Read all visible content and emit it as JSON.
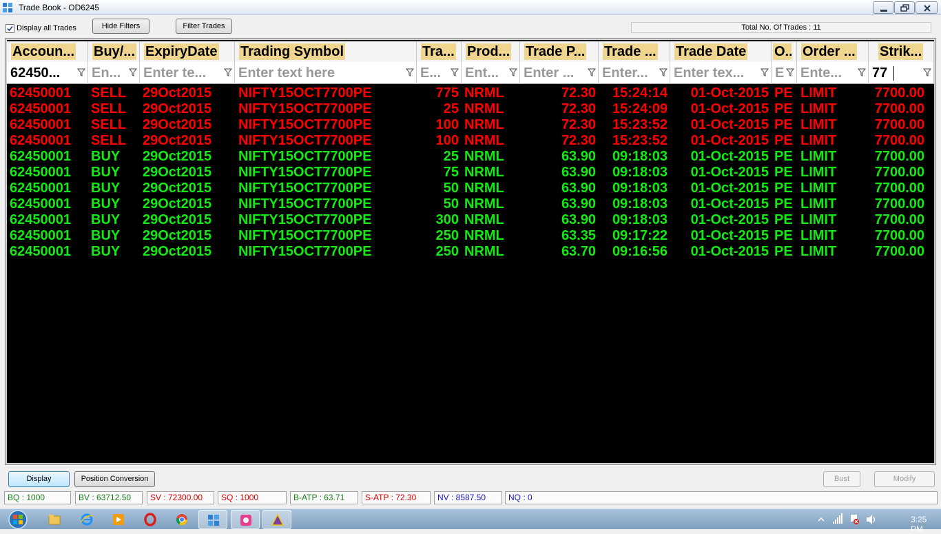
{
  "window": {
    "title": "Trade Book - OD6245"
  },
  "toolbar": {
    "display_all_label": "Display all Trades",
    "display_all_checked": true,
    "hide_filters_label": "Hide Filters",
    "filter_trades_label": "Filter Trades",
    "total_trades_text": "Total No. Of Trades : 11"
  },
  "grid": {
    "columns": [
      {
        "key": "account",
        "label": "Accoun...",
        "filter": "62450...",
        "filter_is_value": true
      },
      {
        "key": "buysell",
        "label": "Buy/...",
        "filter": "En...",
        "filter_is_value": false
      },
      {
        "key": "expiry",
        "label": "ExpiryDate",
        "filter": "Enter te...",
        "filter_is_value": false
      },
      {
        "key": "symbol",
        "label": "Trading Symbol",
        "filter": "Enter text here",
        "filter_is_value": false
      },
      {
        "key": "qty",
        "label": "Tra...",
        "filter": "E...",
        "filter_is_value": false
      },
      {
        "key": "product",
        "label": "Prod...",
        "filter": "Ent...",
        "filter_is_value": false
      },
      {
        "key": "price",
        "label": "Trade P...",
        "filter": "Enter ...",
        "filter_is_value": false
      },
      {
        "key": "time",
        "label": "Trade ...",
        "filter": "Enter...",
        "filter_is_value": false
      },
      {
        "key": "date",
        "label": "Trade Date",
        "filter": "Enter tex...",
        "filter_is_value": false
      },
      {
        "key": "opt",
        "label": "O...",
        "filter": "E",
        "filter_is_value": false
      },
      {
        "key": "ordertype",
        "label": "Order ...",
        "filter": "Ente...",
        "filter_is_value": false
      },
      {
        "key": "strike",
        "label": "Strik...",
        "filter": "77",
        "filter_is_value": true
      }
    ],
    "rows": [
      {
        "side_type": "sell",
        "account": "62450001",
        "buysell": "SELL",
        "expiry": "29Oct2015",
        "symbol": "NIFTY15OCT7700PE",
        "qty": "775",
        "product": "NRML",
        "price": "72.30",
        "time": "15:24:14",
        "date": "01-Oct-2015",
        "opt": "PE",
        "ordertype": "LIMIT",
        "strike": "7700.00"
      },
      {
        "side_type": "sell",
        "account": "62450001",
        "buysell": "SELL",
        "expiry": "29Oct2015",
        "symbol": "NIFTY15OCT7700PE",
        "qty": "25",
        "product": "NRML",
        "price": "72.30",
        "time": "15:24:09",
        "date": "01-Oct-2015",
        "opt": "PE",
        "ordertype": "LIMIT",
        "strike": "7700.00"
      },
      {
        "side_type": "sell",
        "account": "62450001",
        "buysell": "SELL",
        "expiry": "29Oct2015",
        "symbol": "NIFTY15OCT7700PE",
        "qty": "100",
        "product": "NRML",
        "price": "72.30",
        "time": "15:23:52",
        "date": "01-Oct-2015",
        "opt": "PE",
        "ordertype": "LIMIT",
        "strike": "7700.00"
      },
      {
        "side_type": "sell",
        "account": "62450001",
        "buysell": "SELL",
        "expiry": "29Oct2015",
        "symbol": "NIFTY15OCT7700PE",
        "qty": "100",
        "product": "NRML",
        "price": "72.30",
        "time": "15:23:52",
        "date": "01-Oct-2015",
        "opt": "PE",
        "ordertype": "LIMIT",
        "strike": "7700.00"
      },
      {
        "side_type": "buy",
        "account": "62450001",
        "buysell": "BUY",
        "expiry": "29Oct2015",
        "symbol": "NIFTY15OCT7700PE",
        "qty": "25",
        "product": "NRML",
        "price": "63.90",
        "time": "09:18:03",
        "date": "01-Oct-2015",
        "opt": "PE",
        "ordertype": "LIMIT",
        "strike": "7700.00"
      },
      {
        "side_type": "buy",
        "account": "62450001",
        "buysell": "BUY",
        "expiry": "29Oct2015",
        "symbol": "NIFTY15OCT7700PE",
        "qty": "75",
        "product": "NRML",
        "price": "63.90",
        "time": "09:18:03",
        "date": "01-Oct-2015",
        "opt": "PE",
        "ordertype": "LIMIT",
        "strike": "7700.00"
      },
      {
        "side_type": "buy",
        "account": "62450001",
        "buysell": "BUY",
        "expiry": "29Oct2015",
        "symbol": "NIFTY15OCT7700PE",
        "qty": "50",
        "product": "NRML",
        "price": "63.90",
        "time": "09:18:03",
        "date": "01-Oct-2015",
        "opt": "PE",
        "ordertype": "LIMIT",
        "strike": "7700.00"
      },
      {
        "side_type": "buy",
        "account": "62450001",
        "buysell": "BUY",
        "expiry": "29Oct2015",
        "symbol": "NIFTY15OCT7700PE",
        "qty": "50",
        "product": "NRML",
        "price": "63.90",
        "time": "09:18:03",
        "date": "01-Oct-2015",
        "opt": "PE",
        "ordertype": "LIMIT",
        "strike": "7700.00"
      },
      {
        "side_type": "buy",
        "account": "62450001",
        "buysell": "BUY",
        "expiry": "29Oct2015",
        "symbol": "NIFTY15OCT7700PE",
        "qty": "300",
        "product": "NRML",
        "price": "63.90",
        "time": "09:18:03",
        "date": "01-Oct-2015",
        "opt": "PE",
        "ordertype": "LIMIT",
        "strike": "7700.00"
      },
      {
        "side_type": "buy",
        "account": "62450001",
        "buysell": "BUY",
        "expiry": "29Oct2015",
        "symbol": "NIFTY15OCT7700PE",
        "qty": "250",
        "product": "NRML",
        "price": "63.35",
        "time": "09:17:22",
        "date": "01-Oct-2015",
        "opt": "PE",
        "ordertype": "LIMIT",
        "strike": "7700.00"
      },
      {
        "side_type": "buy",
        "account": "62450001",
        "buysell": "BUY",
        "expiry": "29Oct2015",
        "symbol": "NIFTY15OCT7700PE",
        "qty": "250",
        "product": "NRML",
        "price": "63.70",
        "time": "09:16:56",
        "date": "01-Oct-2015",
        "opt": "PE",
        "ordertype": "LIMIT",
        "strike": "7700.00"
      }
    ]
  },
  "actions": {
    "display_label": "Display",
    "position_conversion_label": "Position Conversion",
    "bust_label": "Bust",
    "modify_label": "Modify"
  },
  "status": {
    "bq": {
      "text": "BQ : 1000",
      "color": "#1a7f1a"
    },
    "bv": {
      "text": "BV : 63712.50",
      "color": "#1a7f1a"
    },
    "sv": {
      "text": "SV : 72300.00",
      "color": "#e00000"
    },
    "sq": {
      "text": "SQ : 1000",
      "color": "#e00000"
    },
    "batp": {
      "text": "B-ATP : 63.71",
      "color": "#1a7f1a"
    },
    "satp": {
      "text": "S-ATP : 72.30",
      "color": "#e00000"
    },
    "nv": {
      "text": "NV : 8587.50",
      "color": "#1a1acc"
    },
    "nq": {
      "text": "NQ : 0",
      "color": "#1a1acc"
    }
  },
  "taskbar": {
    "items": [
      "explorer-icon",
      "ie-icon",
      "media-player-icon",
      "opera-icon",
      "chrome-icon",
      "tradebook-app-icon",
      "paint-icon",
      "delta-app-icon"
    ],
    "clock": "3:25 PM"
  },
  "colors": {
    "sell": "#ff0000",
    "buy": "#13ea13",
    "header_label_bg": "#f0d58f",
    "grid_bg": "#000000"
  }
}
